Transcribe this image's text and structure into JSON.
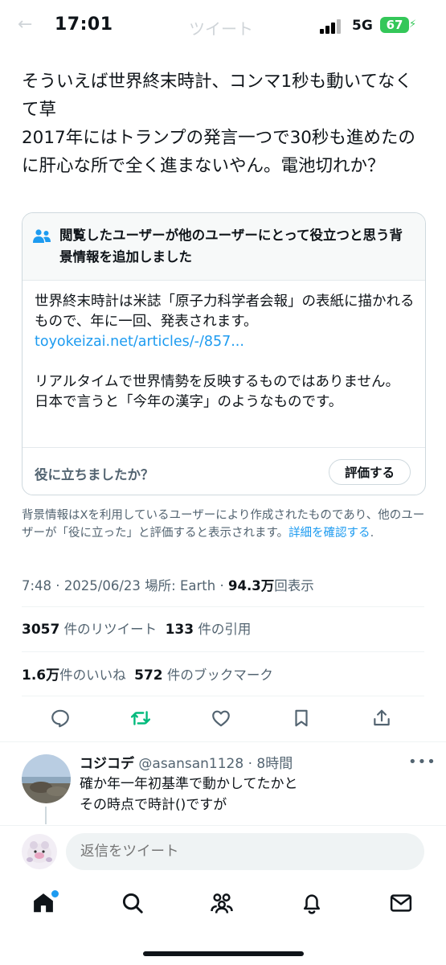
{
  "status_bar": {
    "time": "17:01",
    "network": "5G",
    "battery": "67",
    "ghost_title": "ツイート",
    "ghost_back": "←"
  },
  "tweet": {
    "text": "そういえば世界終末時計、コンマ1秒も動いてなくて草\n2017年にはトランプの発言一つで30秒も進めたのに肝心な所で全く進まないやん。電池切れか？",
    "time": "7:48",
    "date": "2025/06/23",
    "location_label": "場所: Earth",
    "views_value": "94.3万",
    "views_label": "回表示"
  },
  "community_note": {
    "header": "閲覧したユーザーが他のユーザーにとって役立つと思う背景情報を追加しました",
    "body_1": "世界終末時計は米誌「原子力科学者会報」の表紙に描かれるもので、年に一回、発表されます。",
    "link": "toyokeizai.net/articles/-/857...",
    "body_2": "リアルタイムで世界情勢を反映するものではありません。\n日本で言うと「今年の漢字」のようなものです。",
    "helpful_question": "役に立ちましたか？",
    "rate_button": "評価する",
    "disclaimer": "背景情報はXを利用しているユーザーにより作成されたものであり、他のユーザーが「役に立った」と評価すると表示されます。",
    "learn_more": "詳細を確認する",
    "learn_more_suffix": "."
  },
  "stats": {
    "retweets_value": "3057",
    "retweets_label": "件のリツイート",
    "quotes_value": "133",
    "quotes_label": "件の引用",
    "likes_value": "1.6万",
    "likes_label": "件のいいね",
    "bookmarks_value": "572",
    "bookmarks_label": "件のブックマーク"
  },
  "actions": [
    "reply-icon",
    "retweet-icon",
    "like-icon",
    "bookmark-icon",
    "share-icon"
  ],
  "reply": {
    "name": "コジコデ",
    "handle": "@asansan1128",
    "time": "8時間",
    "text": "確か年一年初基準で動かしてたかと\nその時点で時計()ですが"
  },
  "composer": {
    "placeholder": "返信をツイート"
  },
  "tabbar": [
    "home-icon",
    "search-icon",
    "communities-icon",
    "notifications-icon",
    "messages-icon"
  ],
  "colors": {
    "accent": "#1d9bf0",
    "retweet_green": "#00ba7c",
    "battery_green": "#34c759",
    "secondary_text": "#536471"
  }
}
